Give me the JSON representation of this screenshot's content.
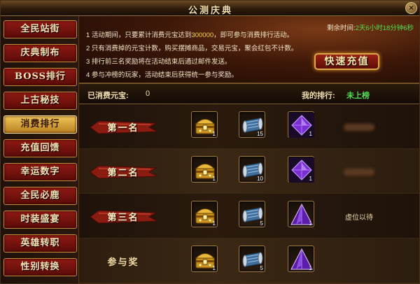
{
  "window": {
    "title": "公测庆典",
    "close_glyph": "×"
  },
  "sidebar": {
    "items": [
      {
        "label": "全民站街",
        "active": false
      },
      {
        "label": "庆典制布",
        "active": false
      },
      {
        "label": "BOSS排行",
        "active": false
      },
      {
        "label": "上古秘技",
        "active": false
      },
      {
        "label": "消费排行",
        "active": true
      },
      {
        "label": "充值回馈",
        "active": false
      },
      {
        "label": "幸运数字",
        "active": false
      },
      {
        "label": "全民必鹿",
        "active": false
      },
      {
        "label": "时装盛宴",
        "active": false
      },
      {
        "label": "英雄转职",
        "active": false
      },
      {
        "label": "性别转换",
        "active": false
      }
    ]
  },
  "banner": {
    "rules": [
      {
        "prefix": "1  活动期间，只要累计消费元宝达到",
        "highlight": "300000",
        "suffix": "，即可参与消费排行活动。"
      },
      {
        "prefix": "2  只有消费掉的元宝计数，购买摆摊商品，交易元宝，聚会红包不计数。",
        "highlight": "",
        "suffix": ""
      },
      {
        "prefix": "3  排行前三名奖励将在活动结束后通过邮件发送。",
        "highlight": "",
        "suffix": ""
      },
      {
        "prefix": "4  参与冲榜的玩家，活动结束后获得统一参与奖励。",
        "highlight": "",
        "suffix": ""
      }
    ],
    "remaining_label": "剩余时间:",
    "remaining_value": "2天6小时18分钟6秒",
    "recharge_button": "快速充值"
  },
  "status": {
    "spent_label": "已消费元宝:",
    "spent_value": "0",
    "my_rank_label": "我的排行:",
    "my_rank_value": "未上榜"
  },
  "ranks": [
    {
      "label": "第一名",
      "ribbon": true,
      "rewards": [
        {
          "icon": "gold-chest-icon",
          "qty": "1"
        },
        {
          "icon": "scroll-icon",
          "qty": "15"
        },
        {
          "icon": "purple-gem-icon",
          "qty": "1"
        }
      ],
      "holder": "",
      "holder_hidden": true
    },
    {
      "label": "第二名",
      "ribbon": true,
      "rewards": [
        {
          "icon": "gold-chest-icon",
          "qty": "1"
        },
        {
          "icon": "scroll-icon",
          "qty": "10"
        },
        {
          "icon": "purple-gem-icon",
          "qty": "1"
        }
      ],
      "holder": "",
      "holder_hidden": true
    },
    {
      "label": "第三名",
      "ribbon": true,
      "rewards": [
        {
          "icon": "gold-chest-icon",
          "qty": "1"
        },
        {
          "icon": "scroll-icon",
          "qty": "5"
        },
        {
          "icon": "purple-crystal-icon",
          "qty": "1"
        }
      ],
      "holder": "虚位以待",
      "holder_hidden": false
    },
    {
      "label": "参与奖",
      "ribbon": false,
      "rewards": [
        {
          "icon": "gold-chest-icon",
          "qty": "1"
        },
        {
          "icon": "scroll-icon",
          "qty": "5"
        },
        {
          "icon": "purple-crystal-icon",
          "qty": "1"
        }
      ],
      "holder": "",
      "holder_hidden": false
    }
  ],
  "colors": {
    "accent_gold": "#f0c75a",
    "highlight_green": "#4fe04f",
    "sidebar_red": "#8f1a13"
  }
}
